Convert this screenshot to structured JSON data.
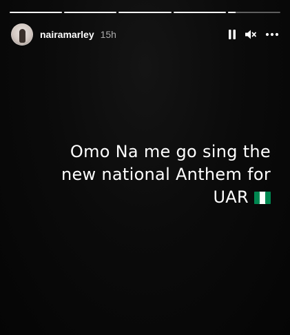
{
  "story": {
    "progress_segments": [
      1,
      1,
      1,
      1,
      0.15
    ],
    "user": {
      "username": "nairamarley",
      "time_ago": "15h"
    },
    "controls": {
      "pause_icon": "pause-icon",
      "mute_icon": "mute-icon",
      "more_icon": "more-options-icon"
    },
    "caption": {
      "line1": "Omo Na me go sing the",
      "line2": "new national Anthem for",
      "line3": "UAR",
      "emoji": "nigeria-flag-icon"
    }
  },
  "colors": {
    "background": "#000000",
    "text": "#ffffff",
    "flag_green": "#008751"
  }
}
